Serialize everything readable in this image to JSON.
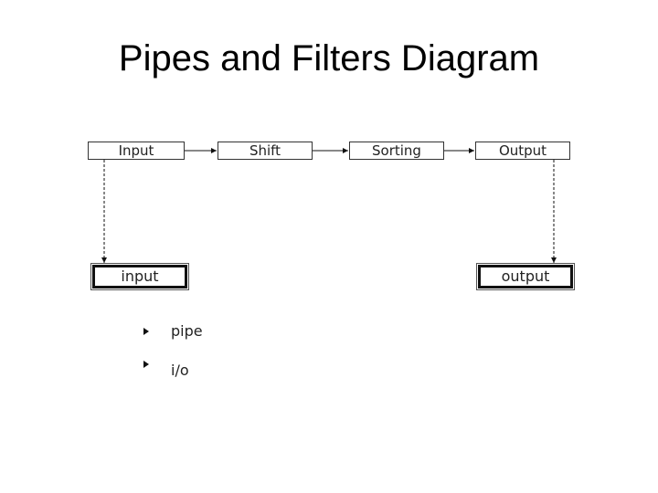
{
  "title": "Pipes and Filters Diagram",
  "filters": [
    "Input",
    "Shift",
    "Sorting",
    "Output"
  ],
  "io": {
    "input": "input",
    "output": "output"
  },
  "legend": [
    {
      "label": "pipe",
      "style": "solid"
    },
    {
      "label": "i/o",
      "style": "dashed"
    }
  ]
}
